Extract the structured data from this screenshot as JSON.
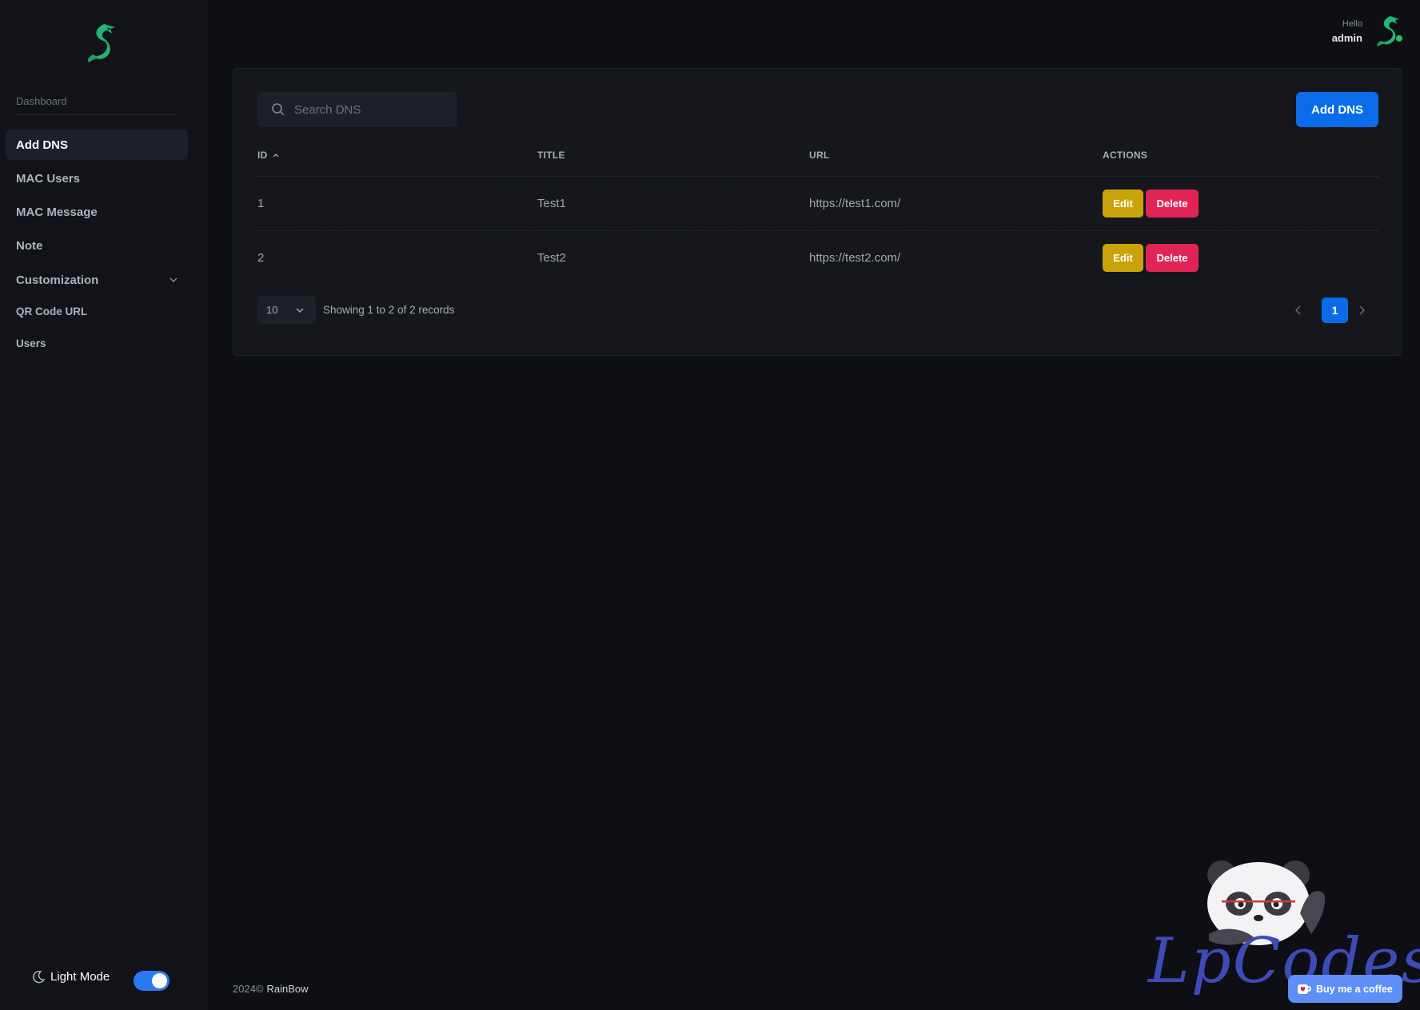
{
  "sidebar": {
    "section_label": "Dashboard",
    "items": [
      {
        "label": "Add DNS",
        "active": true
      },
      {
        "label": "MAC Users"
      },
      {
        "label": "MAC Message"
      },
      {
        "label": "Note"
      },
      {
        "label": "Customization",
        "expandable": true
      },
      {
        "label": "QR Code URL"
      },
      {
        "label": "Users"
      }
    ],
    "mode_label": "Light Mode",
    "mode_toggle_on": true
  },
  "header": {
    "greeting": "Hello",
    "username": "admin"
  },
  "toolbar": {
    "search_placeholder": "Search DNS",
    "search_value": "",
    "add_label": "Add DNS"
  },
  "table": {
    "columns": [
      "ID",
      "TITLE",
      "URL",
      "ACTIONS"
    ],
    "sort_column": "ID",
    "sort_direction": "asc",
    "rows": [
      {
        "id": "1",
        "title": "Test1",
        "url": "https://test1.com/"
      },
      {
        "id": "2",
        "title": "Test2",
        "url": "https://test2.com/"
      }
    ],
    "edit_label": "Edit",
    "delete_label": "Delete"
  },
  "pagination": {
    "page_size": "10",
    "summary": "Showing 1 to 2 of 2 records",
    "current_page": "1"
  },
  "footer": {
    "copyright": "2024©",
    "brand": "RainBow"
  },
  "watermark": {
    "text": "LpCodes",
    "coffee_label": "Buy me a coffee"
  },
  "colors": {
    "accent": "#0a6ce8",
    "edit": "#c9a30a",
    "delete": "#e02456",
    "logo": "#22b573"
  }
}
